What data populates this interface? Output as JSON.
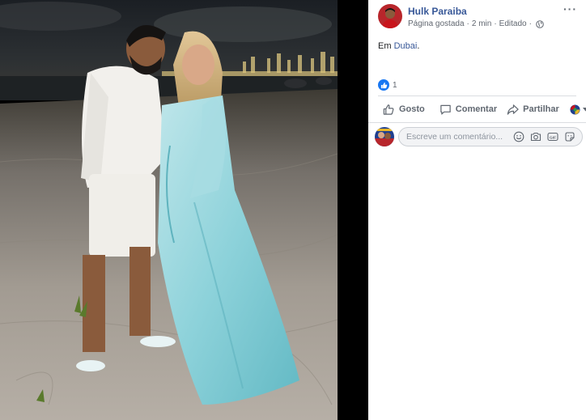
{
  "post": {
    "page_name": "Hulk Paraiba",
    "status": "Página gostada",
    "time": "2 min",
    "edited": "Editado",
    "text_prefix": "Em ",
    "location": "Dubai",
    "text_suffix": "."
  },
  "reactions": {
    "count": "1",
    "type": "like-icon"
  },
  "actions": {
    "like_label": "Gosto",
    "comment_label": "Comentar",
    "share_label": "Partilhar"
  },
  "comment": {
    "placeholder": "Escreve um comentário..."
  },
  "colors": {
    "link_blue": "#385898",
    "facebook_blue": "#1877f2",
    "meta_gray": "#616770",
    "divider": "#dadde1"
  },
  "icons": {
    "more": "more-options-icon",
    "globe": "globe-icon",
    "like": "thumbs-up-icon",
    "comment": "speech-bubble-icon",
    "share": "share-arrow-icon",
    "audience": "audience-selector-icon",
    "emoji": "emoji-icon",
    "camera": "camera-icon",
    "gif": "gif-icon",
    "sticker": "sticker-icon"
  }
}
